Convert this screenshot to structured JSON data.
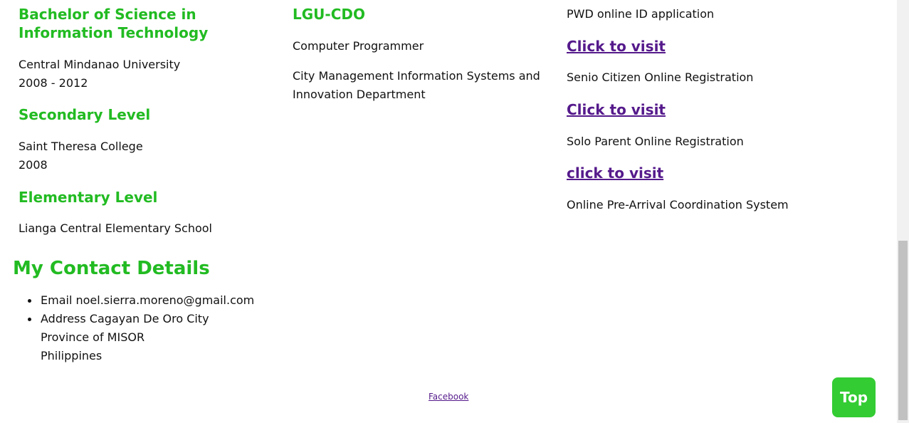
{
  "education": {
    "college_title": "Bachelor of Science in Information Technology",
    "college_school": "Central Mindanao University",
    "college_years": "2008 - 2012",
    "secondary_title": "Secondary Level",
    "secondary_school": "Saint Theresa College",
    "secondary_year": "2008",
    "elementary_title": "Elementary Level",
    "elementary_school": "Lianga Central Elementary School"
  },
  "experience": {
    "employer": "LGU-CDO",
    "position": "Computer Programmer",
    "department": "City Management Information Systems and Innovation Department"
  },
  "projects": [
    {
      "name": "PWD online ID application",
      "link": "Click to visit"
    },
    {
      "name": "Senio Citizen Online Registration",
      "link": "Click to visit"
    },
    {
      "name": "Solo Parent Online Registration",
      "link": "click to visit"
    },
    {
      "name": "Online Pre-Arrival Coordination System"
    }
  ],
  "contact": {
    "title": "My Contact Details",
    "email": "Email noel.sierra.moreno@gmail.com",
    "address_line1": "Address Cagayan De Oro City",
    "address_line2": "Province of MISOR",
    "address_line3": "Philippines"
  },
  "footer": {
    "facebook_label": "Facebook"
  },
  "top_button_label": "Top",
  "colors": {
    "heading_green": "#22bb22",
    "link_purple": "#551a8b",
    "button_green": "#33cc33"
  }
}
